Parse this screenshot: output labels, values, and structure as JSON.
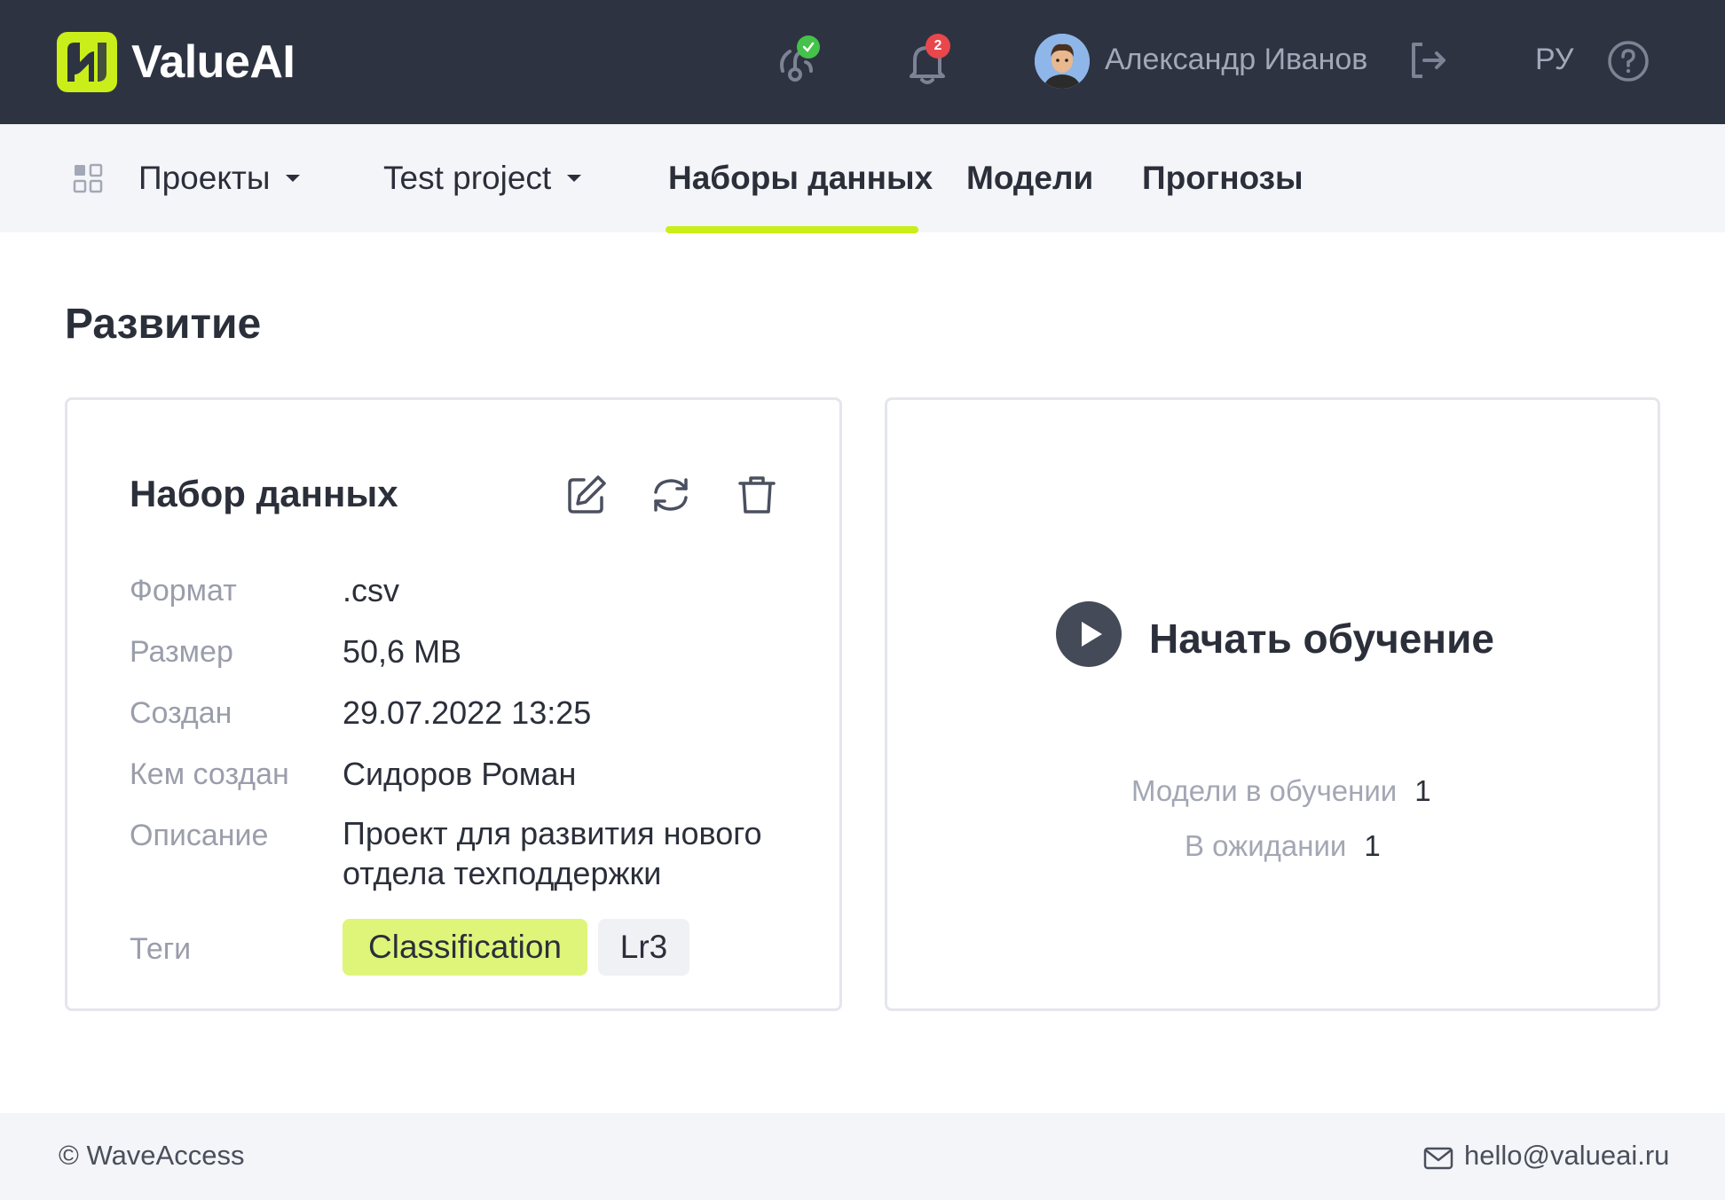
{
  "app": {
    "name": "ValueAI",
    "brand_color": "#c9ee1a",
    "header_bg": "#2e3342"
  },
  "header": {
    "pipeline_status_icon": "pipeline-check-icon",
    "notifications_count": "2",
    "user_name": "Александр Иванов",
    "language": "РУ",
    "icons": [
      "pipeline-icon",
      "bell-icon",
      "avatar",
      "logout-icon",
      "help-icon"
    ]
  },
  "nav": {
    "projects_label": "Проекты",
    "project_label": "Test project",
    "tabs": [
      {
        "label": "Наборы данных",
        "active": true
      },
      {
        "label": "Модели",
        "active": false
      },
      {
        "label": "Прогнозы",
        "active": false
      }
    ]
  },
  "page": {
    "title": "Развитие"
  },
  "dataset_card": {
    "title": "Набор данных",
    "fields": [
      {
        "label": "Формат",
        "value": ".csv"
      },
      {
        "label": "Размер",
        "value": "50,6 MB"
      },
      {
        "label": "Создан",
        "value": "29.07.2022 13:25"
      },
      {
        "label": "Кем создан",
        "value": "Сидоров Роман"
      },
      {
        "label": "Описание",
        "value": "Проект для развития нового отдела техподдержки"
      }
    ],
    "tags_label": "Теги",
    "tags": [
      "Classification",
      "Lr3"
    ]
  },
  "training_card": {
    "start_label": "Начать обучение",
    "stats": [
      {
        "label": "Модели в обучении",
        "value": "1"
      },
      {
        "label": "В ожидании",
        "value": "1"
      }
    ]
  },
  "footer": {
    "copyright": "© WaveAccess",
    "email": "hello@valueai.ru"
  }
}
